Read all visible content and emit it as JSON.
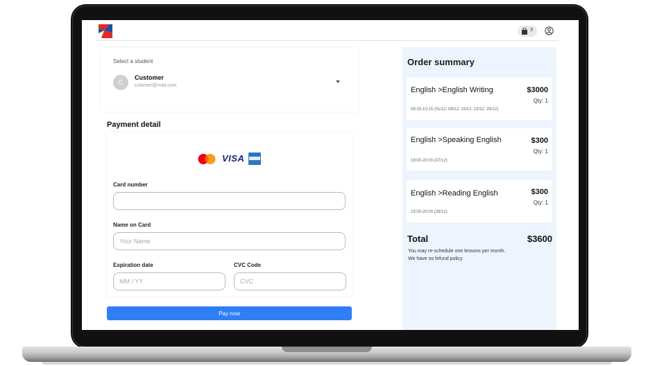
{
  "header": {
    "cart_count": "3"
  },
  "student": {
    "label": "Select a student",
    "avatar_initial": "C",
    "name": "Customer",
    "email": "cutomer@mail.com"
  },
  "payment": {
    "title": "Payment detail",
    "brand_visa": "VISA",
    "card_number_label": "Card number",
    "card_number_value": "",
    "name_label": "Name on Card",
    "name_placeholder": "Your Name",
    "expiry_label": "Expiration date",
    "expiry_placeholder": "MM / YY",
    "cvc_label": "CVC Code",
    "cvc_placeholder": "CVC",
    "pay_button": "Pay now"
  },
  "summary": {
    "title": "Order summary",
    "items": [
      {
        "title": "English >English Writing",
        "price": "$3000",
        "qty": "Qty:  1",
        "time": "09:15-10:15 (01/12, 08/12, 15/12, 22/12, 29/12)"
      },
      {
        "title": "English >Speaking English",
        "price": "$300",
        "qty": "Qty:  1",
        "time": "19:00-20:00 (07/12)"
      },
      {
        "title": "English >Reading English",
        "price": "$300",
        "qty": "Qty:  1",
        "time": "19:00-20:00 (28/12)"
      }
    ],
    "total_label": "Total",
    "total_value": "$3600",
    "note_1": "You may re-schedule one lessons per month.",
    "note_2": "We have no fefund policy"
  },
  "colors": {
    "accent": "#2f7ef6",
    "summary_bg": "#eef4fd",
    "logo_red": "#e02b2b",
    "logo_blue": "#1f4fa3"
  },
  "icons": [
    "logo-icon",
    "shopping-bag-icon",
    "user-circle-icon",
    "chevron-down-icon",
    "mastercard-icon",
    "amex-icon"
  ]
}
